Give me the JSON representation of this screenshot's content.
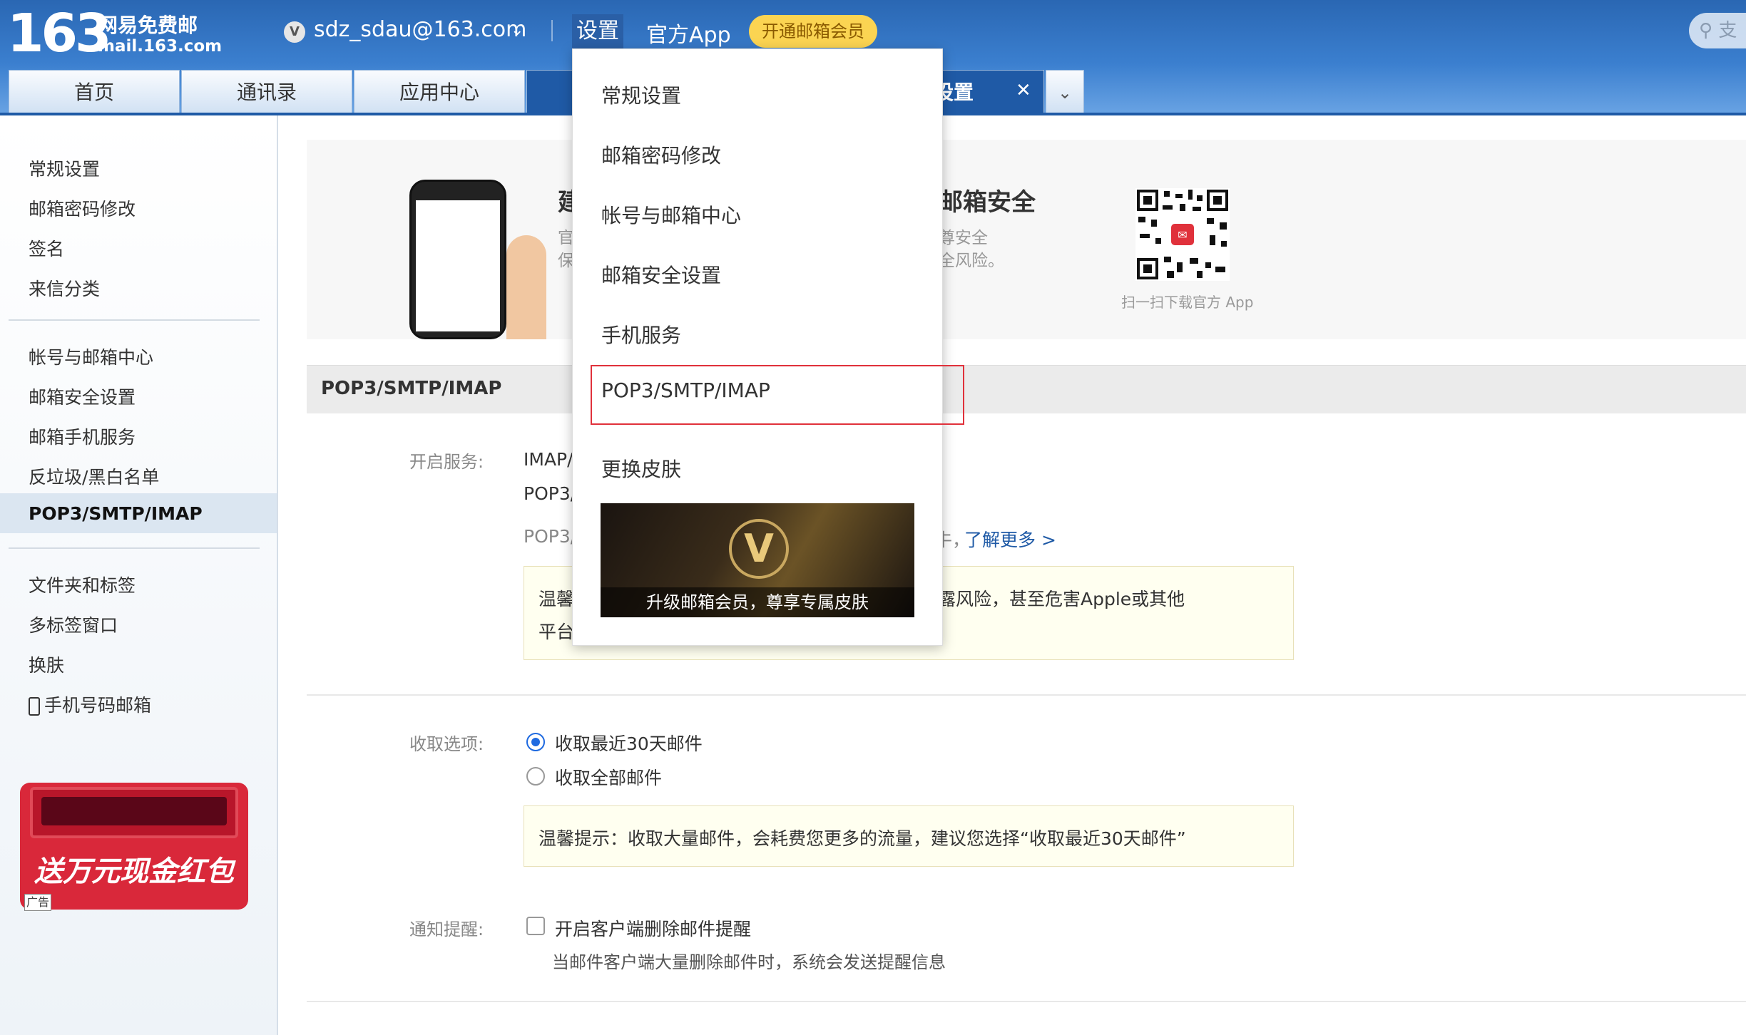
{
  "header": {
    "logo_number": "163",
    "logo_cn": "网易免费邮",
    "logo_en": "mail.163.com",
    "account": "sdz_sdau@163.com",
    "settings_link": "设置",
    "app_link": "官方App",
    "vip_button": "开通邮箱会员",
    "search_placeholder": "支"
  },
  "tabs": [
    {
      "label": "首页"
    },
    {
      "label": "通讯录"
    },
    {
      "label": "应用中心"
    },
    {
      "label": "设置"
    }
  ],
  "sidebar": {
    "group1": [
      "常规设置",
      "邮箱密码修改",
      "签名",
      "来信分类"
    ],
    "group2": [
      "帐号与邮箱中心",
      "邮箱安全设置",
      "邮箱手机服务",
      "反垃圾/黑白名单",
      "POP3/SMTP/IMAP"
    ],
    "group3": [
      "文件夹和标签",
      "多标签窗口",
      "换肤",
      "手机号码邮箱"
    ],
    "ad_text": "送万元现金红包",
    "ad_badge": "广告"
  },
  "promo": {
    "title_left": "建",
    "desc_left": [
      "官",
      "保"
    ],
    "title_right": "邮箱安全",
    "desc_right": [
      "尊安全",
      "全风险。"
    ],
    "qr_caption": "扫一扫下载官方 App"
  },
  "section": {
    "title": "POP3/SMTP/IMAP",
    "service_label": "开启服务:",
    "service_lines": [
      "IMAP/",
      "POP3/",
      "POP3/"
    ],
    "learn_more": "了解更多 >",
    "learn_prefix": "牛，",
    "warning_partial": "露风险，甚至危害Apple或其他",
    "warning_start": "温馨",
    "warning_line2": "平台",
    "receive_label": "收取选项:",
    "receive_options": [
      "收取最近30天邮件",
      "收取全部邮件"
    ],
    "receive_selected": "收取最近30天邮件",
    "receive_tip": "温馨提示：收取大量邮件，会耗费您更多的流量，建议您选择“收取最近30天邮件”",
    "notify_label": "通知提醒:",
    "notify_checkbox": "开启客户端删除邮件提醒",
    "notify_checked": false,
    "notify_desc": "当邮件客户端大量删除邮件时，系统会发送提醒信息"
  },
  "dropdown": {
    "items": [
      "常规设置",
      "邮箱密码修改",
      "帐号与邮箱中心",
      "邮箱安全设置",
      "手机服务",
      "POP3/SMTP/IMAP",
      "更换皮肤"
    ],
    "highlighted": "POP3/SMTP/IMAP",
    "banner_badge": "V",
    "banner_text": "升级邮箱会员，尊享专属皮肤"
  },
  "colors": {
    "header_blue": "#2a67b3",
    "highlight_red": "#e0313b",
    "vip_yellow": "#fbd452",
    "link_blue": "#1f5aa6"
  }
}
